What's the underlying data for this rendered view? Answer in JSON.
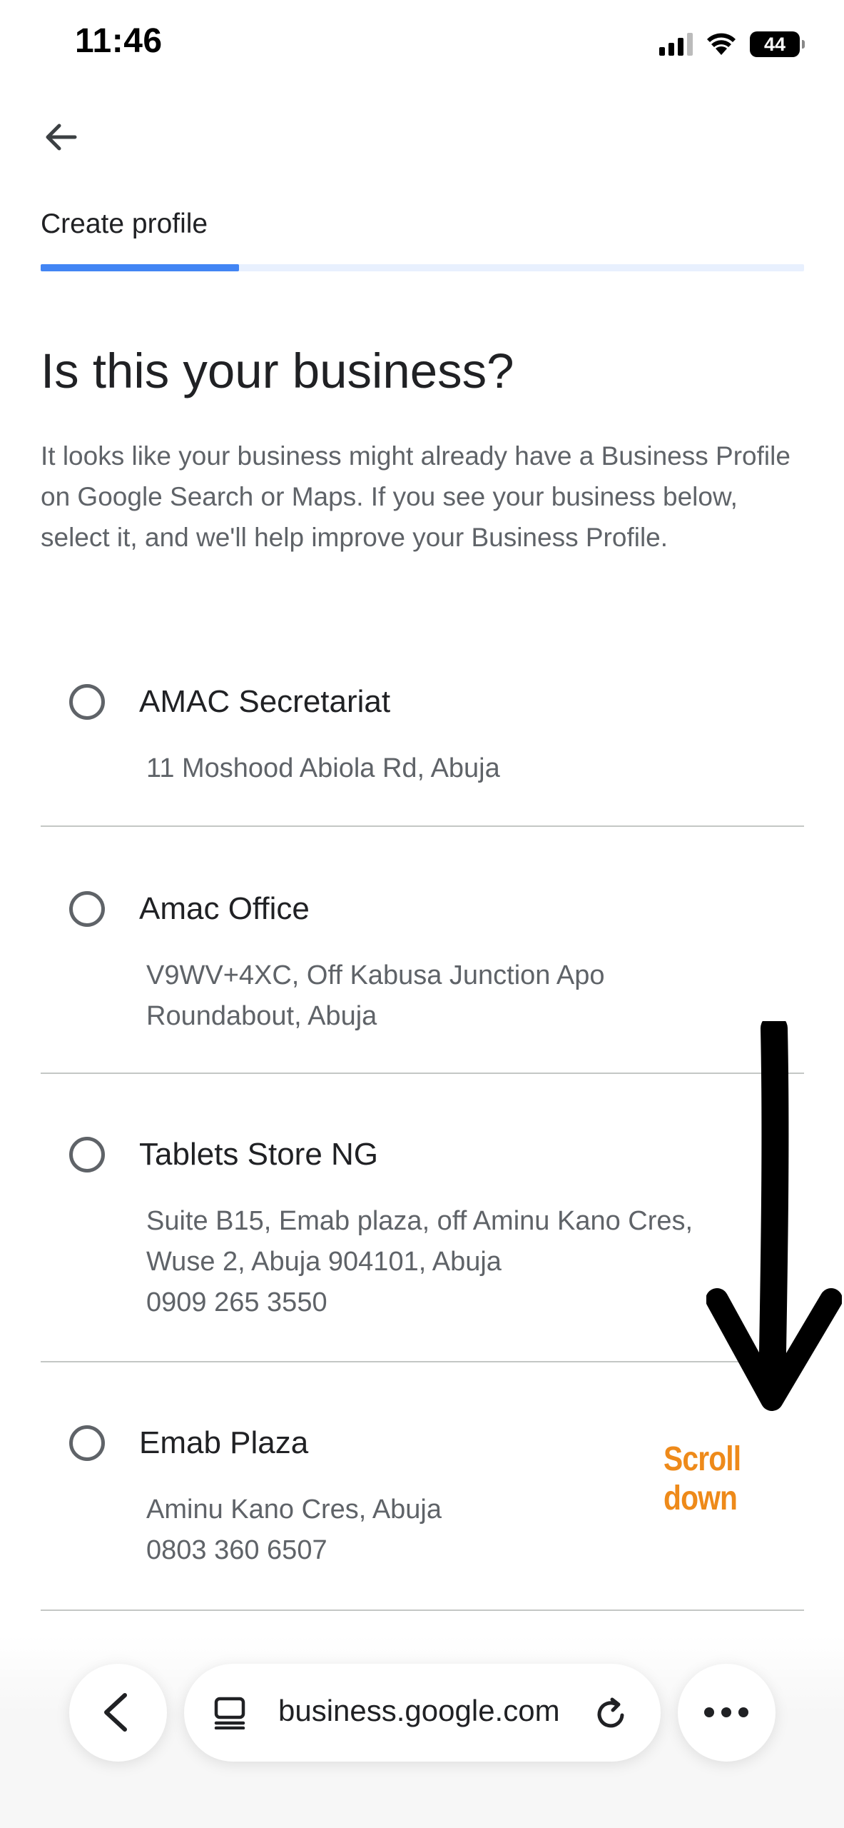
{
  "status_bar": {
    "time": "11:46",
    "battery": "44",
    "icons": [
      "signal-icon",
      "wifi-icon",
      "battery-icon"
    ]
  },
  "header": {
    "back_icon": "arrow-left-icon",
    "step_label": "Create profile",
    "progress_fraction": 0.26,
    "accent_color": "#4285f4"
  },
  "main": {
    "title": "Is this your business?",
    "description": "It looks like your business might already have a Business Profile on Google Search or Maps. If you see your business below, select it, and we'll help improve your Business Profile.",
    "options": [
      {
        "name": "AMAC Secretariat",
        "address": [
          "11 Moshood Abiola Rd, Abuja"
        ]
      },
      {
        "name": "Amac Office",
        "address": [
          "V9WV+4XC, Off Kabusa Junction Apo",
          "Roundabout, Abuja"
        ]
      },
      {
        "name": "Tablets Store NG",
        "address": [
          "Suite B15, Emab plaza, off Aminu Kano Cres,",
          "Wuse 2, Abuja 904101, Abuja",
          "0909 265 3550"
        ]
      },
      {
        "name": "Emab Plaza",
        "address": [
          "Aminu Kano Cres, Abuja",
          "0803 360 6507"
        ]
      }
    ]
  },
  "annotation": {
    "label": "Scroll down",
    "color": "#ee8a1a"
  },
  "browser_bar": {
    "url": "business.google.com",
    "icons": [
      "chevron-left-icon",
      "page-icon",
      "reload-icon",
      "more-icon"
    ]
  }
}
